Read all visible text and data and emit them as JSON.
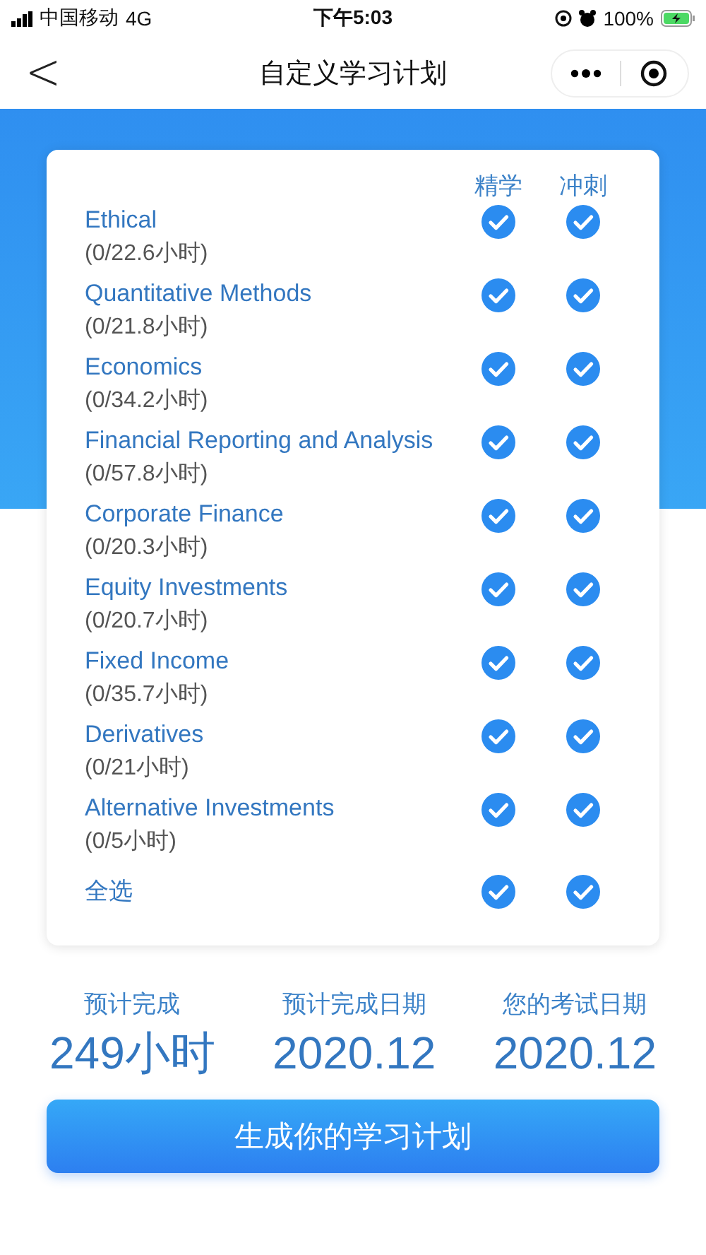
{
  "status_bar": {
    "carrier": "中国移动",
    "network": "4G",
    "time": "下午5:03",
    "battery": "100%"
  },
  "nav": {
    "back": "<",
    "title": "自定义学习计划"
  },
  "columns": [
    "精学",
    "冲刺"
  ],
  "subjects": [
    {
      "name": "Ethical",
      "hours": "(0/22.6小时)",
      "study": true,
      "sprint": true
    },
    {
      "name": "Quantitative Methods",
      "hours": "(0/21.8小时)",
      "study": true,
      "sprint": true
    },
    {
      "name": "Economics",
      "hours": "(0/34.2小时)",
      "study": true,
      "sprint": true
    },
    {
      "name": "Financial Reporting and Analysis",
      "hours": "(0/57.8小时)",
      "study": true,
      "sprint": true
    },
    {
      "name": "Corporate Finance",
      "hours": "(0/20.3小时)",
      "study": true,
      "sprint": true
    },
    {
      "name": "Equity Investments",
      "hours": "(0/20.7小时)",
      "study": true,
      "sprint": true
    },
    {
      "name": "Fixed Income",
      "hours": "(0/35.7小时)",
      "study": true,
      "sprint": true
    },
    {
      "name": "Derivatives",
      "hours": "(0/21小时)",
      "study": true,
      "sprint": true
    },
    {
      "name": "Alternative Investments",
      "hours": "(0/5小时)",
      "study": true,
      "sprint": true
    }
  ],
  "select_all": {
    "label": "全选",
    "study": true,
    "sprint": true
  },
  "summary": [
    {
      "label": "预计完成",
      "value": "249小时"
    },
    {
      "label": "预计完成日期",
      "value": "2020.12"
    },
    {
      "label": "您的考试日期",
      "value": "2020.12"
    }
  ],
  "generate_button": "生成你的学习计划"
}
